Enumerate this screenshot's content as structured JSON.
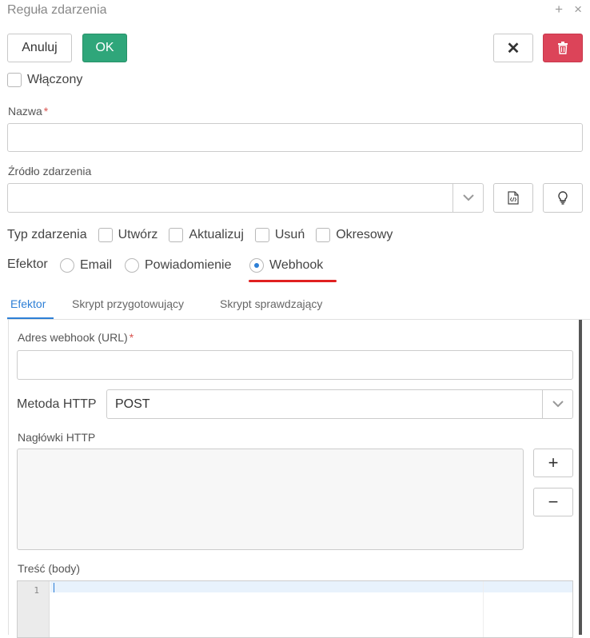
{
  "window": {
    "title": "Reguła zdarzenia",
    "add_glyph": "+",
    "close_glyph": "×"
  },
  "toolbar": {
    "cancel_label": "Anuluj",
    "ok_label": "OK",
    "close_glyph": "✕",
    "delete_icon": "trash-icon"
  },
  "enabled": {
    "label": "Włączony",
    "checked": false
  },
  "name_field": {
    "label": "Nazwa",
    "required": "*",
    "value": ""
  },
  "source_field": {
    "label": "Źródło zdarzenia",
    "value": ""
  },
  "event_type": {
    "label": "Typ zdarzenia",
    "options": [
      {
        "label": "Utwórz",
        "checked": false
      },
      {
        "label": "Aktualizuj",
        "checked": false
      },
      {
        "label": "Usuń",
        "checked": false
      },
      {
        "label": "Okresowy",
        "checked": false
      }
    ]
  },
  "effector": {
    "label": "Efektor",
    "options": [
      {
        "label": "Email",
        "selected": false
      },
      {
        "label": "Powiadomienie",
        "selected": false
      },
      {
        "label": "Webhook",
        "selected": true
      }
    ]
  },
  "tabs": [
    {
      "label": "Efektor",
      "active": true
    },
    {
      "label": "Skrypt przygotowujący",
      "active": false
    },
    {
      "label": "Skrypt sprawdzający",
      "active": false
    }
  ],
  "webhook": {
    "url_label": "Adres webhook (URL)",
    "url_required": "*",
    "url_value": "",
    "method_label": "Metoda HTTP",
    "method_value": "POST",
    "headers_label": "Nagłówki HTTP",
    "add_glyph": "+",
    "remove_glyph": "−",
    "body_label": "Treść (body)",
    "body_line_number": "1"
  },
  "colors": {
    "accent": "#2d7fd6",
    "ok": "#2fa67a",
    "danger": "#dc4459",
    "annotation": "#e02020"
  }
}
